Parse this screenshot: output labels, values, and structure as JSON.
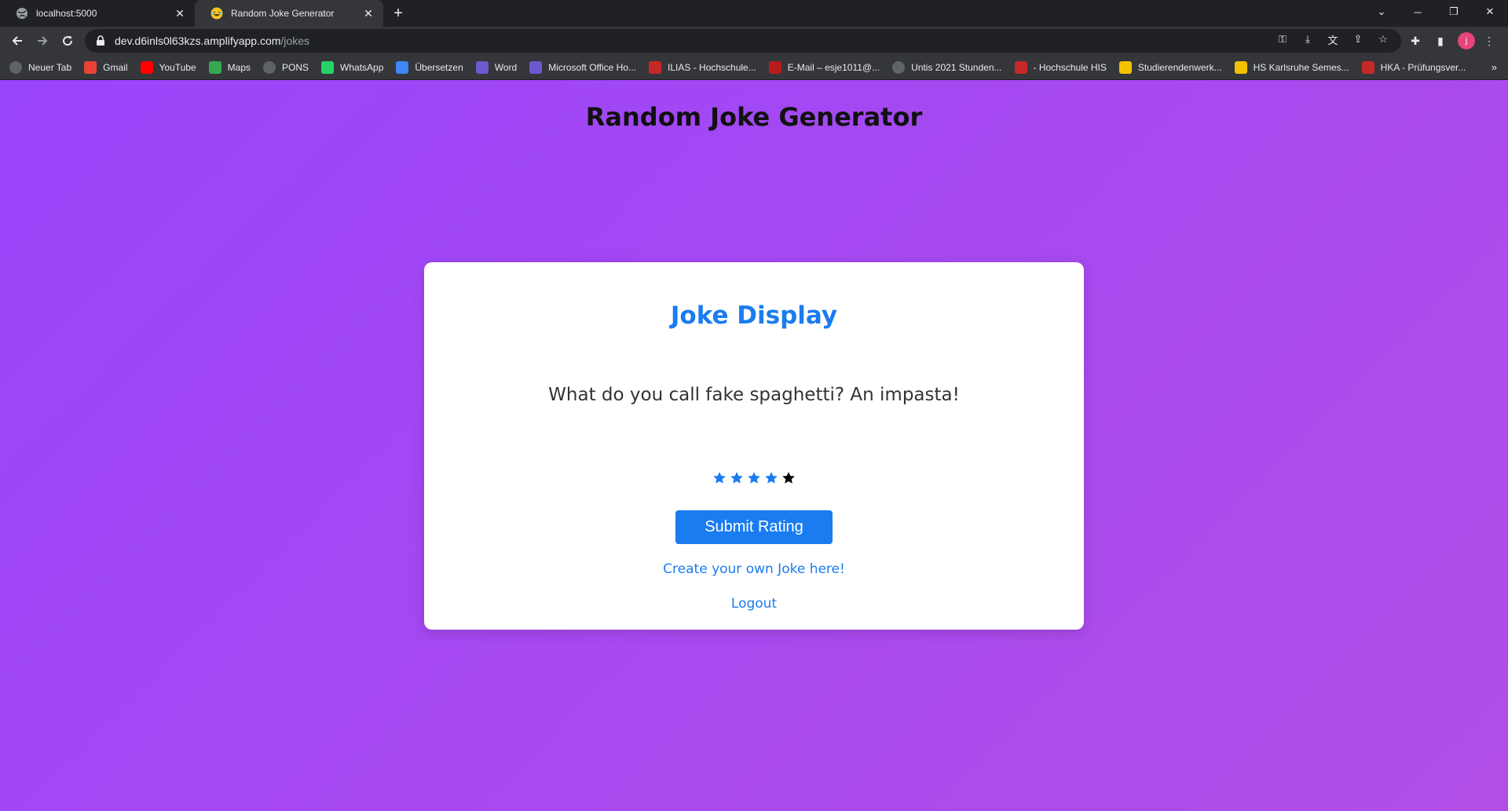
{
  "browser": {
    "tabs": [
      {
        "title": "localhost:5000"
      },
      {
        "title": "Random Joke Generator"
      }
    ],
    "url_host": "dev.d6inls0l63kzs.amplifyapp.com",
    "url_path": "/jokes"
  },
  "bookmarks": [
    {
      "label": "Neuer Tab",
      "icon": "globe-icon",
      "color": "#5f6368"
    },
    {
      "label": "Gmail",
      "icon": "gmail-icon",
      "color": "#ea4335"
    },
    {
      "label": "YouTube",
      "icon": "youtube-icon",
      "color": "#ff0000"
    },
    {
      "label": "Maps",
      "icon": "maps-icon",
      "color": "#34a853"
    },
    {
      "label": "PONS",
      "icon": "globe-icon",
      "color": "#5f6368"
    },
    {
      "label": "WhatsApp",
      "icon": "whatsapp-icon",
      "color": "#25d366"
    },
    {
      "label": "Übersetzen",
      "icon": "translate-icon",
      "color": "#4285f4"
    },
    {
      "label": "Word",
      "icon": "office-icon",
      "color": "#6a5acd"
    },
    {
      "label": "Microsoft Office Ho...",
      "icon": "office-icon",
      "color": "#6a5acd"
    },
    {
      "label": "ILIAS - Hochschule...",
      "icon": "hka-icon",
      "color": "#c62828"
    },
    {
      "label": "E-Mail – esje1011@...",
      "icon": "mail-icon",
      "color": "#b71c1c"
    },
    {
      "label": "Untis 2021 Stunden...",
      "icon": "globe-icon",
      "color": "#5f6368"
    },
    {
      "label": "- Hochschule HIS",
      "icon": "hka-icon",
      "color": "#c62828"
    },
    {
      "label": "Studierendenwerk...",
      "icon": "studierendenwerk-icon",
      "color": "#f2c200"
    },
    {
      "label": "HS Karlsruhe Semes...",
      "icon": "hs-icon",
      "color": "#f2c200"
    },
    {
      "label": "HKA - Prüfungsver...",
      "icon": "hka-icon",
      "color": "#c62828"
    }
  ],
  "page": {
    "title": "Random Joke Generator",
    "card_title": "Joke Display",
    "joke": "What do you call fake spaghetti? An impasta!",
    "rating": {
      "filled": 4,
      "max": 5,
      "filled_color": "#1a7cf0",
      "empty_color": "#000000"
    },
    "submit_label": "Submit Rating",
    "create_link": "Create your own Joke here!",
    "logout_link": "Logout"
  },
  "colors": {
    "accent": "#1a7cf0",
    "gradient_start": "#9a44fb",
    "gradient_end": "#b24ee6"
  }
}
